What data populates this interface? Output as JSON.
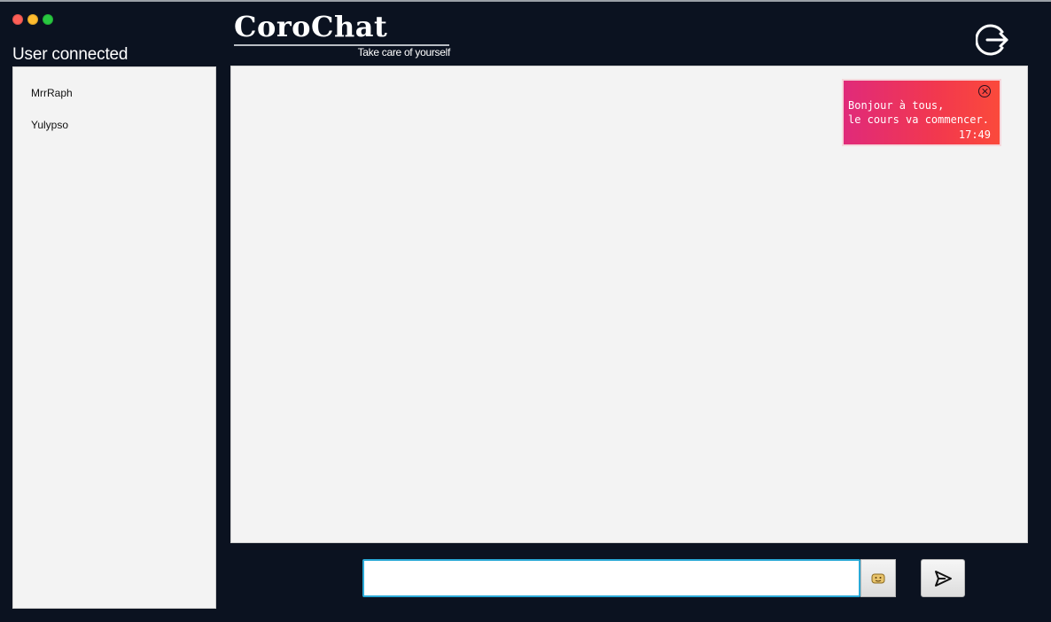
{
  "users_panel": {
    "title": "User connected",
    "users": [
      "MrrRaph",
      "Yulypso"
    ]
  },
  "brand": {
    "name": "CoroChat",
    "tagline": "Take care of yourself"
  },
  "toolbar": {
    "logout_icon": "logout-icon"
  },
  "messages": [
    {
      "lines": [
        "Bonjour à tous,",
        "le cours va commencer."
      ],
      "time": "17:49",
      "gradient": [
        "#e02a7a",
        "#fb4a3b"
      ]
    }
  ],
  "composer": {
    "input_value": "",
    "emoji_icon": "emoji-icon",
    "send_icon": "send-icon"
  },
  "colors": {
    "background": "#0b1220",
    "panel": "#f3f3f3",
    "input_focus": "#2aa9d6"
  }
}
